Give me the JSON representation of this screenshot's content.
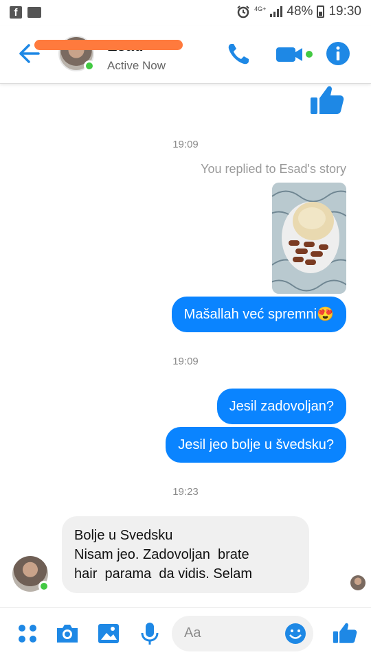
{
  "status_bar": {
    "network": "4G+",
    "battery": "48%",
    "time": "19:30"
  },
  "header": {
    "contact_name": "Esad",
    "presence": "Active Now"
  },
  "messages": {
    "timestamp_1": "19:09",
    "story_reply_note": "You replied to Esad's story",
    "reply_text": "Mašallah već spremni",
    "reply_emoji": "😍",
    "timestamp_2": "19:09",
    "out_1": "Jesil zadovoljan?",
    "out_2": "Jesil jeo bolje u švedsku?",
    "timestamp_3": "19:23",
    "in_line_1": "Bolje u Svedsku",
    "in_line_2": "Nisam jeo. Zadovoljan  brate",
    "in_line_3": "hair  parama  da vidis. Selam"
  },
  "composer": {
    "placeholder": "Aa"
  },
  "colors": {
    "accent": "#0a84ff",
    "online": "#43c943",
    "redaction": "#ff7a3d"
  }
}
